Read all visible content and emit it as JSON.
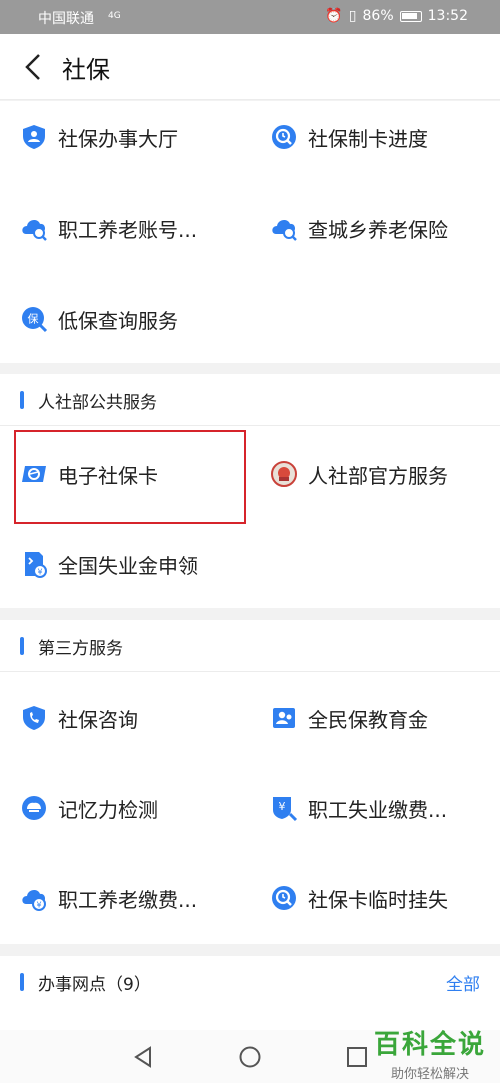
{
  "status": {
    "carrier": "中国联通",
    "signal": "4G",
    "battery": "86%",
    "time": "13:52"
  },
  "header": {
    "title": "社保"
  },
  "social_security": {
    "items": [
      {
        "label": "社保办事大厅",
        "icon": "shield-person-icon"
      },
      {
        "label": "社保制卡进度",
        "icon": "clock-search-icon"
      },
      {
        "label": "职工养老账号...",
        "icon": "cloud-search-icon"
      },
      {
        "label": "查城乡养老保险",
        "icon": "cloud-search-icon"
      },
      {
        "label": "低保查询服务",
        "icon": "bao-search-icon"
      }
    ]
  },
  "mohrss": {
    "title": "人社部公共服务",
    "items": [
      {
        "label": "电子社保卡",
        "icon": "ecard-icon"
      },
      {
        "label": "人社部官方服务",
        "icon": "mohrss-emblem-icon"
      },
      {
        "label": "全国失业金申领",
        "icon": "document-yuan-icon"
      }
    ]
  },
  "third_party": {
    "title": "第三方服务",
    "items": [
      {
        "label": "社保咨询",
        "icon": "shield-phone-icon"
      },
      {
        "label": "全民保教育金",
        "icon": "person-card-icon"
      },
      {
        "label": "记忆力检测",
        "icon": "brain-icon"
      },
      {
        "label": "职工失业缴费...",
        "icon": "yuan-shield-icon"
      },
      {
        "label": "职工养老缴费...",
        "icon": "cloud-yuan-icon"
      },
      {
        "label": "社保卡临时挂失",
        "icon": "clock-search-icon"
      }
    ]
  },
  "outlets": {
    "title": "办事网点（9）",
    "more": "全部"
  },
  "watermark": {
    "big": "百科全说",
    "small": "助你轻松解决"
  },
  "colors": {
    "accent": "#2f7ff0",
    "highlight": "#d6242b",
    "watermark": "#3aa63a"
  }
}
